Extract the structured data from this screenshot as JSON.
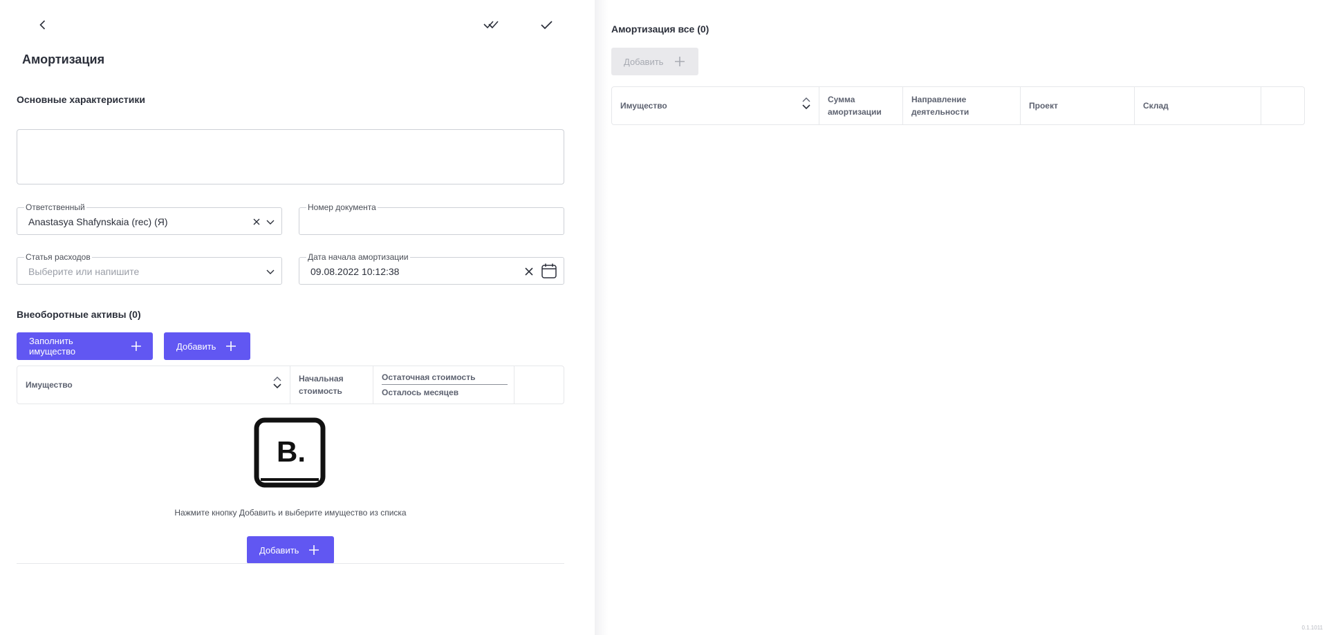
{
  "header": {
    "title": "Амортизация"
  },
  "main_section": {
    "title": "Основные характеристики"
  },
  "fields": {
    "responsible": {
      "label": "Ответственный",
      "value": "Anastasya Shafynskaia (rec) (Я)"
    },
    "doc_number": {
      "label": "Номер документа",
      "value": ""
    },
    "expense_item": {
      "label": "Статья расходов",
      "placeholder": "Выберите или напишите"
    },
    "start_date": {
      "label": "Дата начала амортизации",
      "value": "09.08.2022 10:12:38"
    }
  },
  "assets": {
    "title": "Внеоборотные активы (0)",
    "fill_button": "Заполнить имущество",
    "add_button": "Добавить",
    "columns": {
      "property": "Имущество",
      "initial_cost": "Начальная стоимость",
      "residual_cost": "Остаточная стоимость",
      "months_left": "Осталось месяцев"
    },
    "empty_text": "Нажмите кнопку Добавить и выберите имущество из списка",
    "empty_add_button": "Добавить",
    "empty_logo_letter": "B."
  },
  "depreciation": {
    "title": "Амортизация все (0)",
    "add_button": "Добавить",
    "columns": {
      "property": "Имущество",
      "amount": "Сумма амортизации",
      "direction": "Направление деятельности",
      "project": "Проект",
      "warehouse": "Склад"
    }
  },
  "version": "0.1.1011",
  "colors": {
    "accent": "#6157f2",
    "border": "#cdd0d6",
    "text": "#2b2f3a"
  }
}
